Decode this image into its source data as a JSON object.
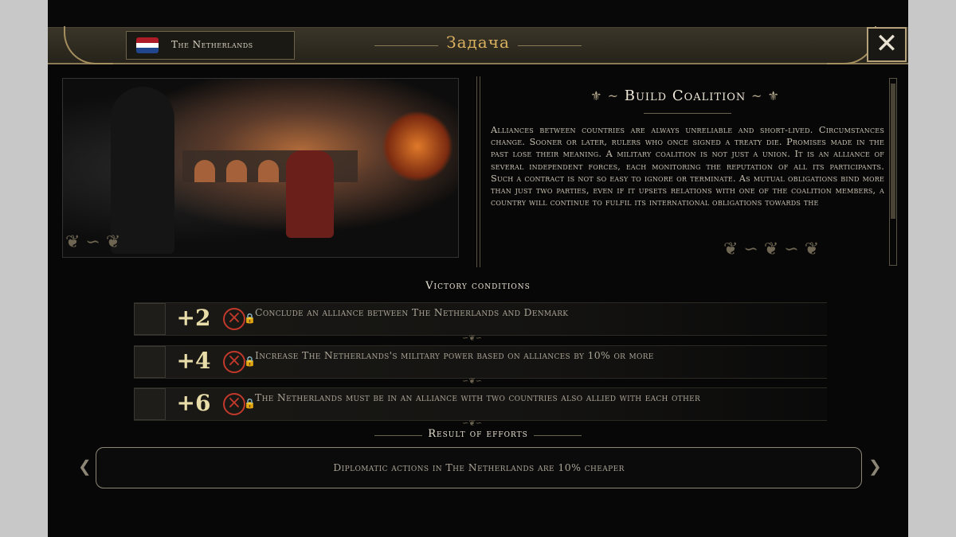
{
  "window": {
    "country": "The Netherlands",
    "title": "Задача",
    "close_label": "✕"
  },
  "flag_colors": [
    "#ae1c28",
    "#ffffff",
    "#21468b"
  ],
  "mission": {
    "title": "Build Coalition",
    "description": "Alliances between countries are always unreliable and short-lived. Circumstances change. Sooner or later, rulers who once signed a treaty die. Promises made in the past lose their meaning. A military coalition is not just a union. It is an alliance of several independent forces, each monitoring the reputation of all its participants. Such a contract is not so easy to ignore or terminate. As mutual obligations bind more than just two parties, even if it upsets relations with one of the coalition members, a country will continue to fulfil its international obligations towards the"
  },
  "victory": {
    "title": "Victory conditions",
    "conditions": [
      {
        "points": "+2",
        "text": "Conclude an alliance between The Netherlands and Denmark",
        "status_icon": "failed-x-icon"
      },
      {
        "points": "+4",
        "text": "Increase The Netherlands's military power based on alliances by 10% or more",
        "status_icon": "failed-x-icon"
      },
      {
        "points": "+6",
        "text": "The Netherlands must be in an alliance with two countries also allied with each other",
        "status_icon": "failed-x-icon"
      }
    ]
  },
  "result": {
    "title": "Result of efforts",
    "text": "Diplomatic actions in The Netherlands are 10% cheaper"
  },
  "accent_colors": {
    "gold": "#d9b15f",
    "fail_red": "#c0392b"
  }
}
